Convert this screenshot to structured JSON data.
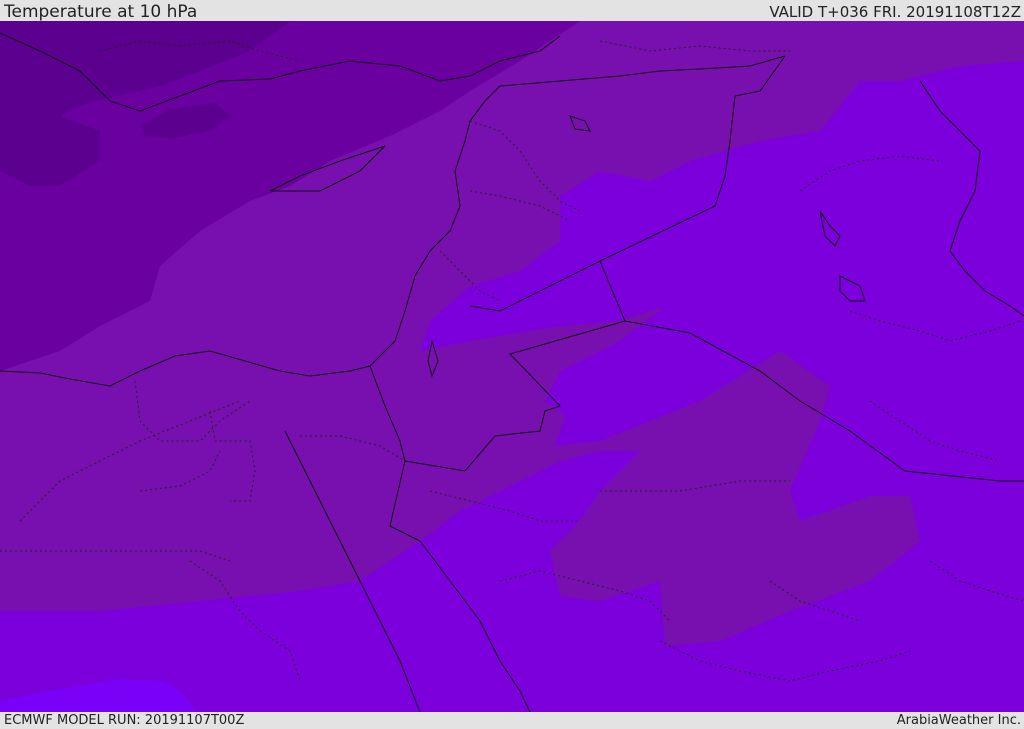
{
  "header": {
    "title": "Temperature at 10 hPa",
    "valid": "VALID T+036 FRI. 20191108T12Z"
  },
  "footer": {
    "model_run": "ECMWF MODEL RUN: 20191107T00Z",
    "credit": "ArabiaWeather Inc."
  },
  "map": {
    "colors": {
      "darkest": "#5c0090",
      "dark": "#6a00a0",
      "medium": "#7810b0",
      "light": "#7c00dc",
      "lightest": "#7a00f8",
      "border": "#111111"
    },
    "layers": [
      "temperature-fill",
      "country-borders",
      "province-borders",
      "coastlines"
    ]
  }
}
